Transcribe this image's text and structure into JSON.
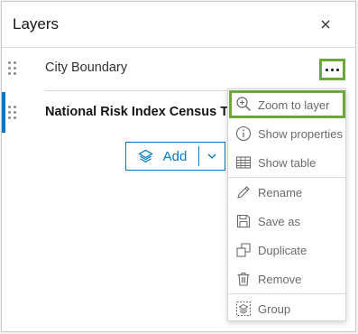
{
  "panel": {
    "title": "Layers"
  },
  "layers": [
    {
      "name": "City Boundary"
    },
    {
      "name": "National Risk Index Census Tracts"
    }
  ],
  "add_button": {
    "label": "Add"
  },
  "context_menu": {
    "items": [
      {
        "label": "Zoom to layer",
        "icon": "zoom-to-layer-icon"
      },
      {
        "label": "Show properties",
        "icon": "info-icon"
      },
      {
        "label": "Show table",
        "icon": "table-icon"
      },
      {
        "label": "Rename",
        "icon": "pencil-icon"
      },
      {
        "label": "Save as",
        "icon": "save-icon"
      },
      {
        "label": "Duplicate",
        "icon": "duplicate-icon"
      },
      {
        "label": "Remove",
        "icon": "trash-icon"
      },
      {
        "label": "Group",
        "icon": "group-icon"
      }
    ]
  },
  "colors": {
    "accent": "#0079c1",
    "highlight": "#6aa93a"
  }
}
